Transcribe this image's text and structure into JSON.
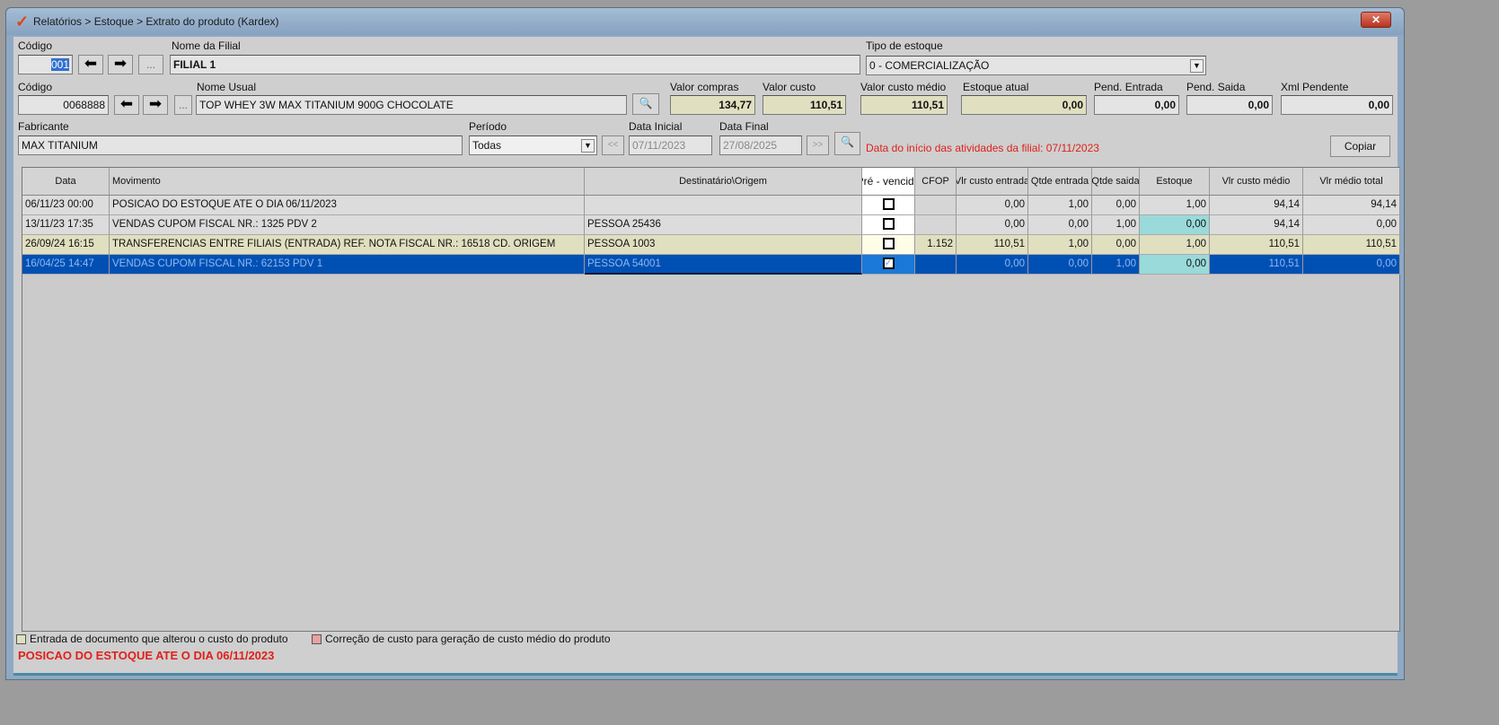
{
  "window": {
    "title": "Relatórios > Estoque > Extrato do produto (Kardex)",
    "close": "✕"
  },
  "filial": {
    "codigo_label": "Código",
    "codigo": "001",
    "nome_label": "Nome da Filial",
    "nome": "FILIAL 1",
    "tipo_label": "Tipo de estoque",
    "tipo": "0 - COMERCIALIZAÇÃO",
    "dots": "..."
  },
  "produto": {
    "codigo_label": "Código",
    "codigo": "0068888",
    "nome_label": "Nome Usual",
    "nome": "TOP WHEY 3W MAX TITANIUM 900G CHOCOLATE",
    "dots": "..."
  },
  "valores": {
    "valor_compras_label": "Valor compras",
    "valor_compras": "134,77",
    "valor_custo_label": "Valor custo",
    "valor_custo": "110,51",
    "valor_custo_medio_label": "Valor custo médio",
    "valor_custo_medio": "110,51",
    "estoque_atual_label": "Estoque atual",
    "estoque_atual": "0,00",
    "pend_entrada_label": "Pend. Entrada",
    "pend_entrada": "0,00",
    "pend_saida_label": "Pend. Saida",
    "pend_saida": "0,00",
    "xml_pendente_label": "Xml Pendente",
    "xml_pendente": "0,00"
  },
  "filtro": {
    "fabricante_label": "Fabricante",
    "fabricante": "MAX TITANIUM",
    "periodo_label": "Período",
    "periodo": "Todas",
    "prev": "<<",
    "next": ">>",
    "data_inicial_label": "Data Inicial",
    "data_inicial": "07/11/2023",
    "data_final_label": "Data Final",
    "data_final": "27/08/2025",
    "aviso": "Data do início das atividades da filial: 07/11/2023",
    "copiar": "Copiar"
  },
  "grid": {
    "headers": [
      "Data",
      "Movimento",
      "Destinatário\\Origem",
      "Pré - vencido",
      "CFOP",
      "Vlr custo entrada",
      "Qtde entrada",
      "Qtde saida",
      "Estoque",
      "Vlr custo médio",
      "Vlr médio total"
    ],
    "rows": [
      {
        "data": "06/11/23 00:00",
        "mov": "POSICAO DO ESTOQUE ATE O DIA 06/11/2023",
        "dest": "",
        "pre": false,
        "cfop": "",
        "vce": "0,00",
        "qe": "1,00",
        "qs": "0,00",
        "est": "1,00",
        "vcm": "94,14",
        "vmt": "94,14"
      },
      {
        "data": "13/11/23 17:35",
        "mov": "VENDAS CUPOM FISCAL NR.: 1325  PDV  2",
        "dest": "PESSOA 25436",
        "pre": false,
        "cfop": "",
        "vce": "0,00",
        "qe": "0,00",
        "qs": "1,00",
        "est": "0,00",
        "vcm": "94,14",
        "vmt": "0,00"
      },
      {
        "data": "26/09/24 16:15",
        "mov": "TRANSFERENCIAS ENTRE FILIAIS (ENTRADA) REF. NOTA FISCAL NR.: 16518  CD. ORIGEM",
        "dest": "PESSOA 1003",
        "pre": false,
        "cfop": "1.152",
        "vce": "110,51",
        "qe": "1,00",
        "qs": "0,00",
        "est": "1,00",
        "vcm": "110,51",
        "vmt": "110,51"
      },
      {
        "data": "16/04/25 14:47",
        "mov": "VENDAS CUPOM FISCAL NR.: 62153  PDV  1",
        "dest": "PESSOA 54001",
        "pre": true,
        "cfop": "",
        "vce": "0,00",
        "qe": "0,00",
        "qs": "1,00",
        "est": "0,00",
        "vcm": "110,51",
        "vmt": "0,00"
      }
    ]
  },
  "legenda": {
    "entrada": "Entrada de documento que alterou o custo do produto",
    "correcao": "Correção de custo para geração de custo médio do produto",
    "status": "POSICAO DO ESTOQUE ATE O DIA 06/11/2023"
  },
  "colors": {
    "selected": "#0050b4",
    "yellow": "#e0dfc0",
    "cyan": "#9adada",
    "red": "#e0201a"
  }
}
